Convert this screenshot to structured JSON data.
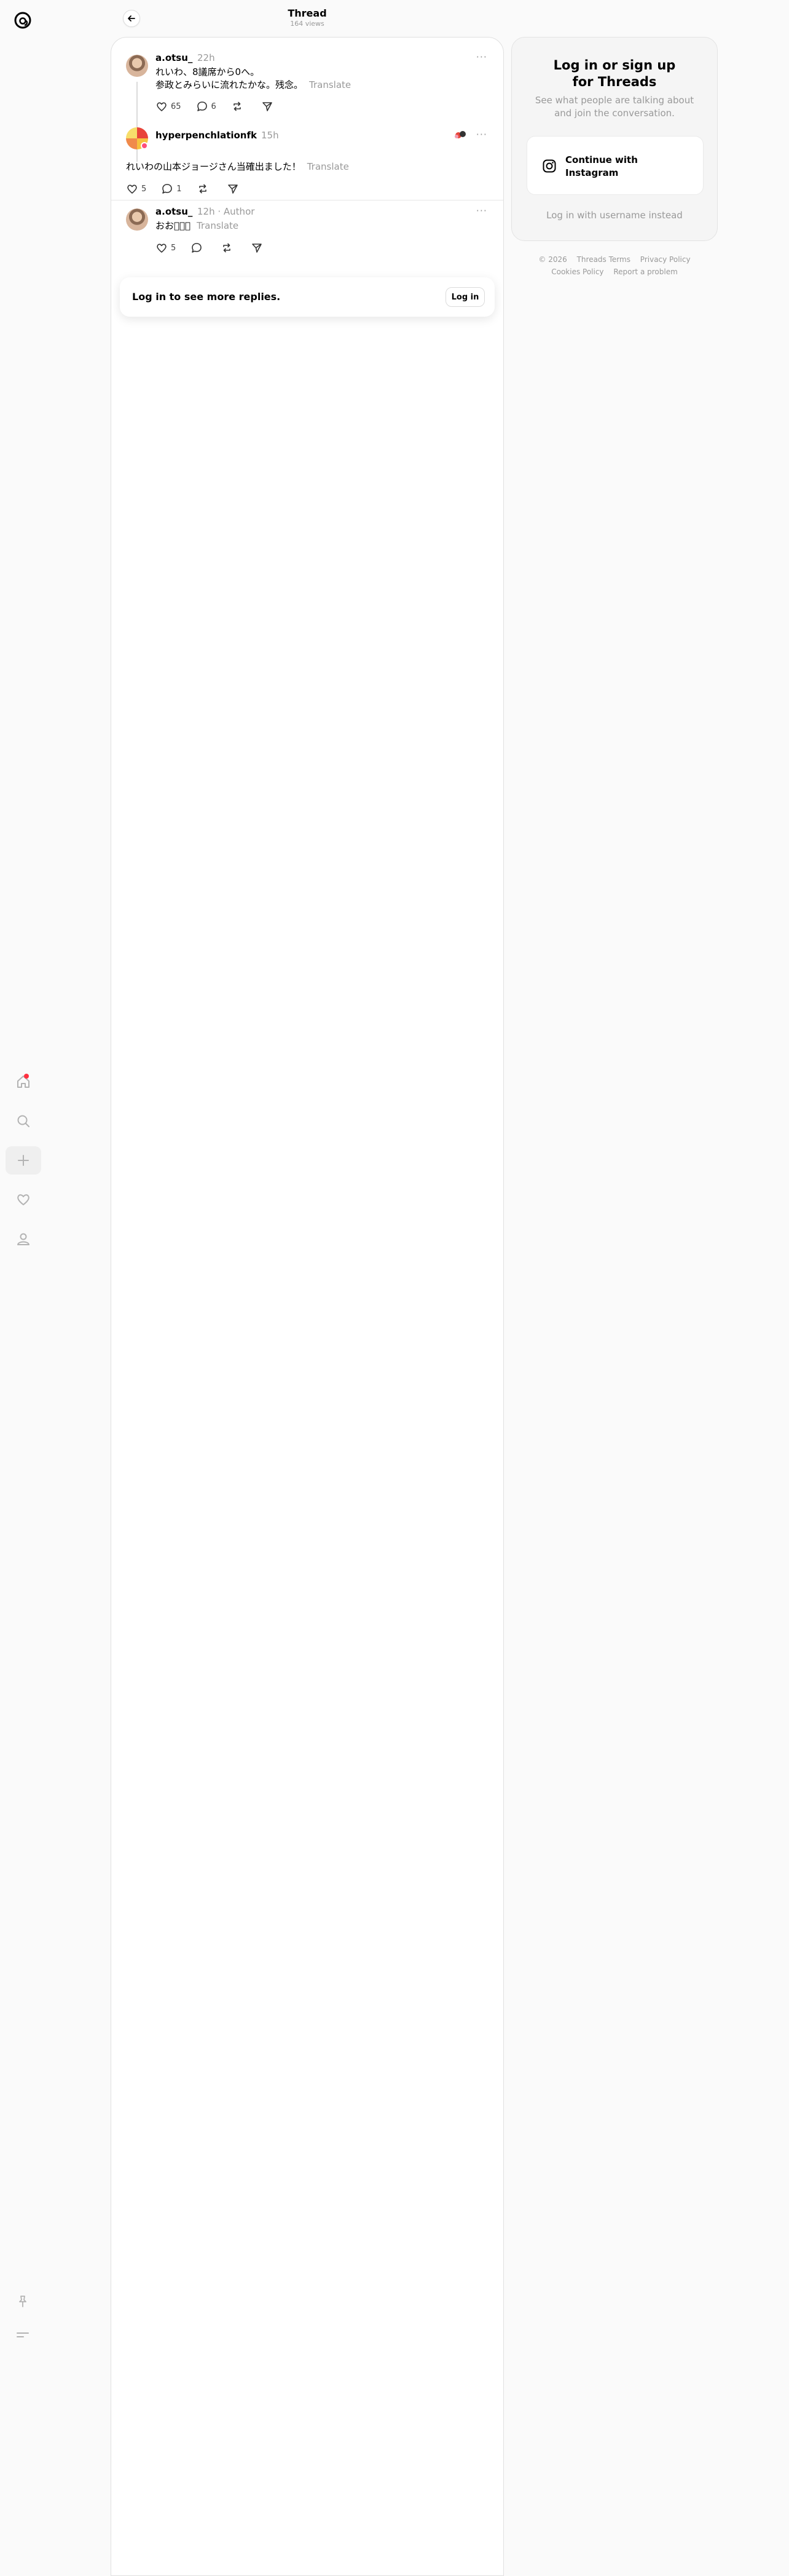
{
  "header": {
    "title": "Thread",
    "subtitle": "164 views"
  },
  "posts": [
    {
      "username": "a.otsu_",
      "time": "22h",
      "lines": [
        "れいわ、8議席から0へ。",
        "参政とみらいに流れたかな。残念。"
      ],
      "translate": "Translate",
      "likes": "65",
      "replies": "6"
    },
    {
      "username": "hyperpenchlationfk",
      "time": "15h",
      "text": "れいわの山本ジョージさん当確出ました！",
      "translate": "Translate",
      "likes": "5",
      "replies": "1"
    },
    {
      "username": "a.otsu_",
      "time": "12h",
      "author_tag": "Author",
      "text": "おお􀀁􀀁􀀁",
      "translate": "Translate",
      "likes": "5"
    }
  ],
  "more_replies": {
    "text": "Log in to see more replies.",
    "button": "Log in"
  },
  "login_card": {
    "title": "Log in or sign up for Threads",
    "subtitle": "See what people are talking about and join the conversation.",
    "instagram_button": "Continue with Instagram",
    "alt_login": "Log in with username instead"
  },
  "footer": {
    "links_row1": [
      "© 2026",
      "Threads Terms",
      "Privacy Policy"
    ],
    "links_row2": [
      "Cookies Policy",
      "Report a problem"
    ]
  },
  "colors": {
    "accent_dot": "#ff3040",
    "muted": "#999999",
    "background": "#fafafa"
  },
  "icons": {
    "sidebar": [
      "home-icon",
      "search-icon",
      "plus-icon",
      "heart-icon",
      "profile-icon"
    ],
    "sidebar_bottom": [
      "pin-icon",
      "menu-icon"
    ],
    "actions": [
      "heart-icon",
      "comment-icon",
      "repost-icon",
      "share-icon"
    ]
  }
}
